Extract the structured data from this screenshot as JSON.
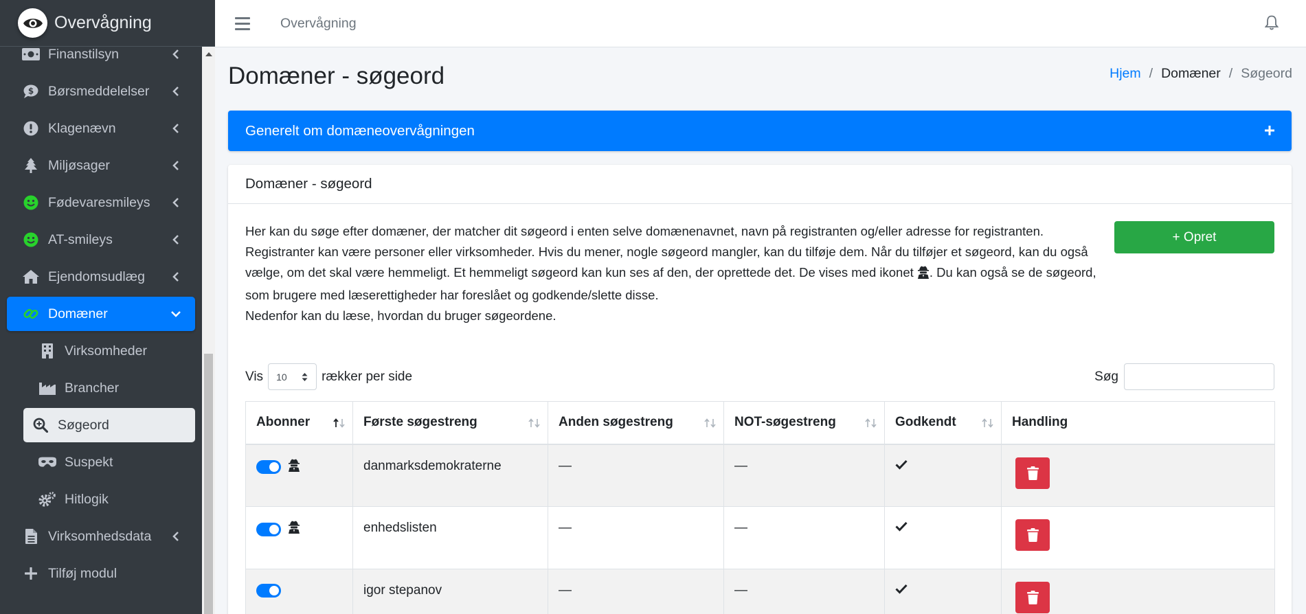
{
  "brand": {
    "name": "Overvågning"
  },
  "sidebar": {
    "items": [
      {
        "label": "Finanstilsyn"
      },
      {
        "label": "Børsmeddelelser"
      },
      {
        "label": "Klagenævn"
      },
      {
        "label": "Miljøsager"
      },
      {
        "label": "Fødevaresmileys"
      },
      {
        "label": "AT-smileys"
      },
      {
        "label": "Ejendomsudlæg"
      },
      {
        "label": "Domæner"
      },
      {
        "label": "Virksomheder"
      },
      {
        "label": "Brancher"
      },
      {
        "label": "Søgeord"
      },
      {
        "label": "Suspekt"
      },
      {
        "label": "Hitlogik"
      },
      {
        "label": "Virksomhedsdata"
      },
      {
        "label": "Tilføj modul"
      }
    ]
  },
  "topbar": {
    "title": "Overvågning"
  },
  "page": {
    "title": "Domæner - søgeord",
    "breadcrumb": {
      "home": "Hjem",
      "section": "Domæner",
      "current": "Søgeord"
    }
  },
  "general_card": {
    "title": "Generelt om domæneovervågningen"
  },
  "main_card": {
    "title": "Domæner - søgeord",
    "description_part1": "Her kan du søge efter domæner, der matcher dit søgeord i enten selve domænenavnet, navn på registranten og/eller adresse for registranten. Registranter kan være personer eller virksomheder. Hvis du mener, nogle søgeord mangler, kan du tilføje dem. Når du tilføjer et søgeord, kan du også vælge, om det skal være hemmeligt. Et hemmeligt søgeord kan kun ses af den, der oprettede det. De vises med ikonet ",
    "description_part2": ". Du kan også se de søgeord, som brugere med læserettigheder har foreslået og godkende/slette disse.",
    "description_line2": "Nedenfor kan du læse, hvordan du bruger søgeordene.",
    "create_button": "+ Opret"
  },
  "table_controls": {
    "show_label": "Vis",
    "page_size": "10",
    "rows_label": "rækker per side",
    "search_label": "Søg",
    "search_value": ""
  },
  "table": {
    "headers": [
      "Abonner",
      "Første søgestreng",
      "Anden søgestreng",
      "NOT-søgestreng",
      "Godkendt",
      "Handling"
    ],
    "rows": [
      {
        "first": "danmarksdemokraterne",
        "second": "—",
        "not": "—",
        "secret": true,
        "approved": true
      },
      {
        "first": "enhedslisten",
        "second": "—",
        "not": "—",
        "secret": true,
        "approved": true
      },
      {
        "first": "igor stepanov",
        "second": "—",
        "not": "—",
        "secret": false,
        "approved": true
      }
    ]
  },
  "colors": {
    "primary": "#007bff",
    "success": "#28a745",
    "danger": "#dc3545",
    "sidebar": "#343a40",
    "smiley": "#28d22c"
  }
}
